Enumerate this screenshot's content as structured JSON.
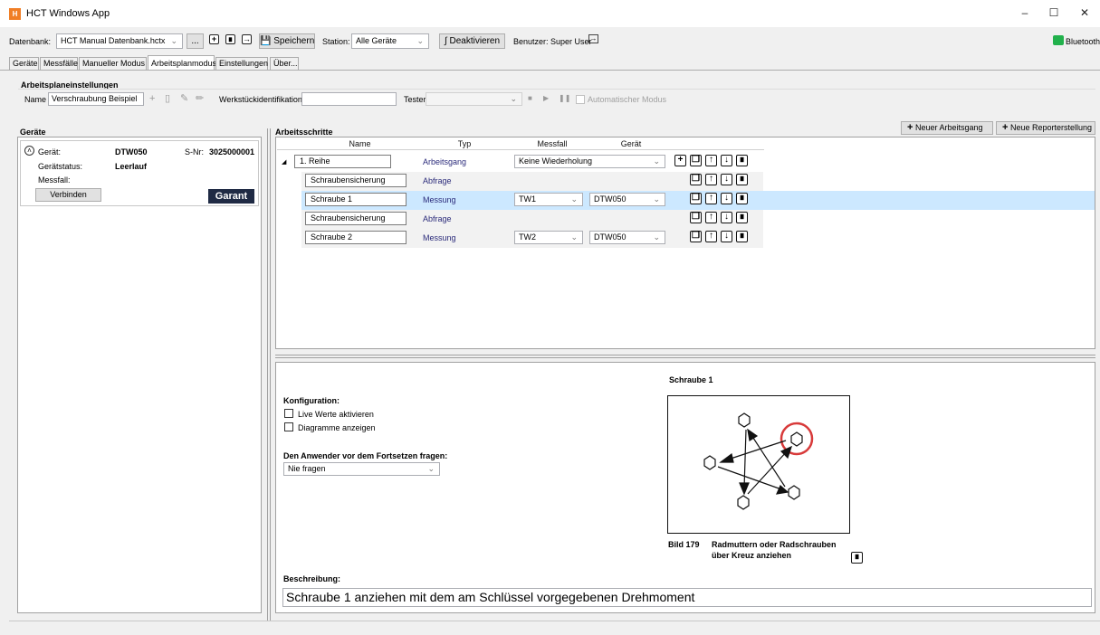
{
  "window": {
    "title": "HCT Windows App",
    "app_icon_glyph": "H"
  },
  "toolbar": {
    "db_label": "Datenbank:",
    "db_value": "HCT Manual Datenbank.hctx",
    "ellipsis_label": "...",
    "save_label": "Speichern",
    "station_label": "Station:",
    "station_value": "Alle Geräte",
    "deactivate_label": "Deaktivieren",
    "user_label": "Benutzer: Super User",
    "bluetooth_label": "Bluetooth",
    "bluetooth_color": "#22b14c"
  },
  "tabs": [
    "Geräte",
    "Messfälle",
    "Manueller Modus",
    "Arbeitsplanmodus",
    "Einstellungen",
    "Über..."
  ],
  "active_tab": "Arbeitsplanmodus",
  "plan_settings": {
    "group_title": "Arbeitsplaneinstellungen",
    "name_label": "Name",
    "name_value": "Verschraubung Beispiel",
    "workpiece_label": "Werkstückidentifikation",
    "workpiece_value": "",
    "tester_label": "Tester",
    "tester_value": "",
    "auto_mode_label": "Automatischer Modus"
  },
  "devices": {
    "title": "Geräte",
    "device_label": "Gerät:",
    "device_value": "DTW050",
    "serial_label": "S-Nr:",
    "serial_value": "3025000001",
    "status_label": "Gerätstatus:",
    "status_value": "Leerlauf",
    "measure_label": "Messfall:",
    "measure_value": "",
    "connect_label": "Verbinden",
    "brand_logo": "Garant"
  },
  "steps": {
    "title": "Arbeitsschritte",
    "new_operation_label": "Neuer Arbeitsgang",
    "new_report_label": "Neue Reporterstellung",
    "columns": [
      "Name",
      "Typ",
      "Messfall",
      "Gerät"
    ],
    "rows": [
      {
        "name": "1. Reihe",
        "type": "Arbeitsgang",
        "measure": "Keine Wiederholung",
        "device": ""
      },
      {
        "name": "Schraubensicherung",
        "type": "Abfrage",
        "measure": "",
        "device": ""
      },
      {
        "name": "Schraube 1",
        "type": "Messung",
        "measure": "TW1",
        "device": "DTW050"
      },
      {
        "name": "Schraubensicherung",
        "type": "Abfrage",
        "measure": "",
        "device": ""
      },
      {
        "name": "Schraube 2",
        "type": "Messung",
        "measure": "TW2",
        "device": "DTW050"
      }
    ]
  },
  "detail": {
    "config_label": "Konfiguration:",
    "live_label": "Live Werte aktivieren",
    "diagram_label": "Diagramme anzeigen",
    "ask_label": "Den Anwender vor dem Fortsetzen fragen:",
    "ask_value": "Nie fragen",
    "image_title": "Schraube 1",
    "caption_number": "Bild 179",
    "caption_line1": "Radmuttern oder Radschrauben",
    "caption_line2": "über Kreuz anziehen",
    "description_label": "Beschreibung:",
    "description_value": "Schraube 1 anziehen mit dem am Schlüssel vorgegebenen Drehmoment"
  }
}
